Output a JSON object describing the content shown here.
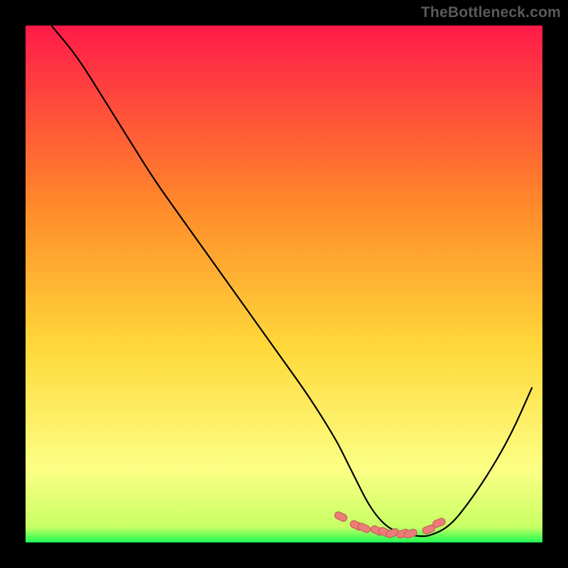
{
  "watermark": "TheBottleneck.com",
  "colors": {
    "frame": "#000000",
    "line": "#000000",
    "markers_fill": "#ed7b78",
    "markers_stroke": "#bd5a56",
    "grad_top": "#ff1a49",
    "grad_mid1": "#ff6a3a",
    "grad_mid2": "#ffd83a",
    "grad_light": "#fcff85",
    "grad_bottom": "#1eff54"
  },
  "chart_data": {
    "type": "line",
    "title": "",
    "xlabel": "",
    "ylabel": "",
    "ylim": [
      0,
      100
    ],
    "xlim": [
      0,
      100
    ],
    "x": [
      5,
      10,
      15,
      20,
      25,
      30,
      35,
      40,
      45,
      50,
      55,
      60,
      62,
      64,
      66,
      68,
      70,
      72,
      74,
      76,
      78,
      82,
      86,
      90,
      94,
      98
    ],
    "values": [
      100,
      94,
      86,
      78,
      70,
      63,
      56,
      49,
      42,
      35,
      28,
      20,
      16,
      12,
      8,
      5,
      3,
      2,
      1.5,
      1.2,
      1.2,
      3,
      8,
      14,
      21,
      30
    ],
    "marker_points": [
      {
        "x": 61,
        "y": 5.0
      },
      {
        "x": 64,
        "y": 3.3
      },
      {
        "x": 65.5,
        "y": 2.8
      },
      {
        "x": 68,
        "y": 2.3
      },
      {
        "x": 69.5,
        "y": 2.0
      },
      {
        "x": 71,
        "y": 1.8
      },
      {
        "x": 73,
        "y": 1.7
      },
      {
        "x": 74.5,
        "y": 1.7
      },
      {
        "x": 78,
        "y": 2.5
      },
      {
        "x": 80,
        "y": 3.8
      }
    ]
  }
}
